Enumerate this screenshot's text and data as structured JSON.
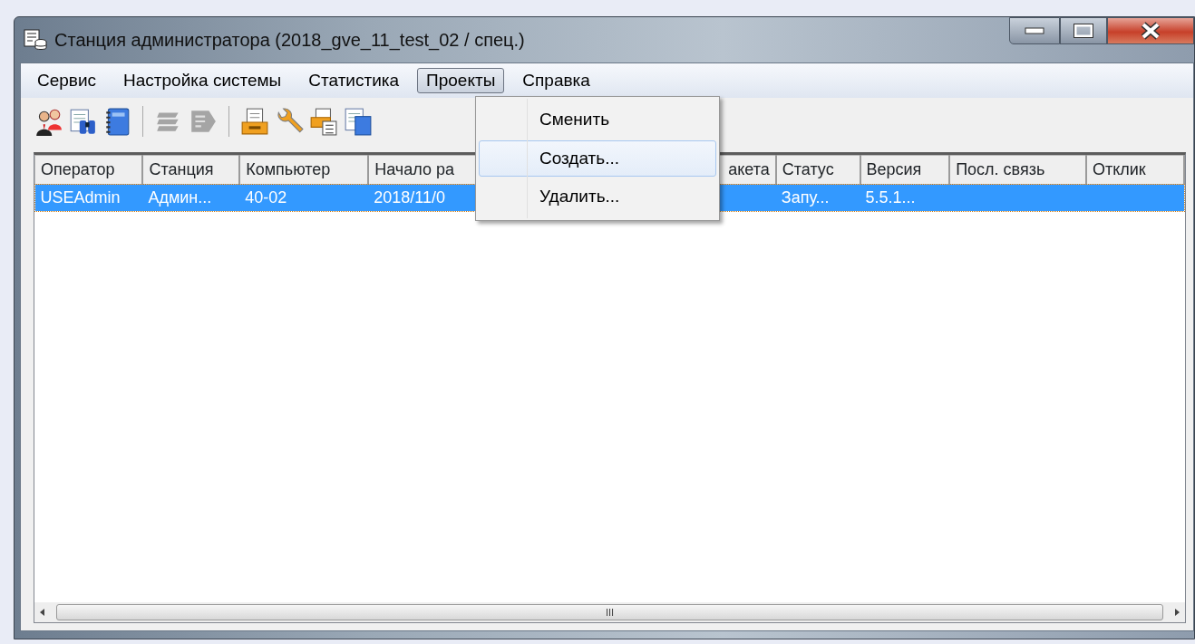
{
  "window": {
    "title": "Станция администратора (2018_gve_11_test_02 / спец.)"
  },
  "menu": [
    {
      "label": "Сервис",
      "selected": false
    },
    {
      "label": "Настройка системы",
      "selected": false
    },
    {
      "label": "Статистика",
      "selected": false
    },
    {
      "label": "Проекты",
      "selected": true
    },
    {
      "label": "Справка",
      "selected": false
    }
  ],
  "toolbar": [
    {
      "disabled": false
    },
    {
      "disabled": false
    },
    {
      "disabled": false
    },
    {
      "disabled": true
    },
    {
      "disabled": true
    },
    {
      "disabled": false
    },
    {
      "disabled": false
    },
    {
      "disabled": false
    },
    {
      "disabled": false
    }
  ],
  "dropdown": {
    "items": [
      {
        "label": "Сменить",
        "selected": false
      },
      {
        "label": "Создать...",
        "selected": true
      },
      {
        "label": "Удалить...",
        "selected": false
      }
    ]
  },
  "table": {
    "columns": [
      "Оператор",
      "Станция",
      "Компьютер",
      "Начало ра",
      "акета",
      "Статус",
      "Версия",
      "Посл. связь",
      "Отклик"
    ],
    "rows": [
      {
        "selected": true,
        "cells": [
          "USEAdmin",
          "Админ...",
          "40-02",
          "2018/11/0",
          "",
          "Запу...",
          "5.5.1...",
          "",
          ""
        ]
      }
    ]
  },
  "scrollbar": {
    "grip": "III"
  }
}
